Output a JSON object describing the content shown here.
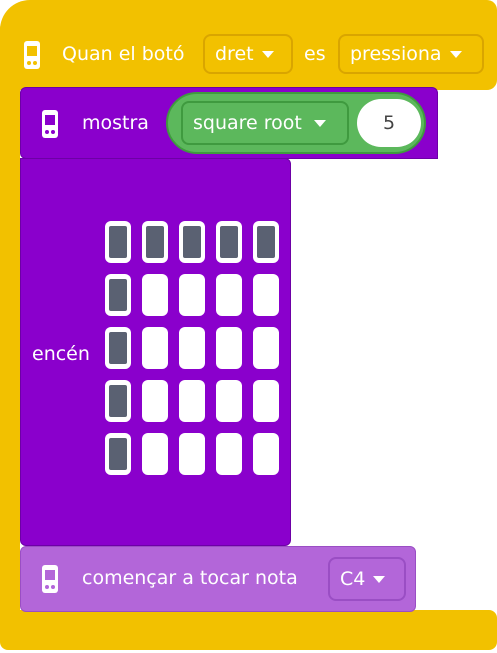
{
  "hat": {
    "label_prefix": "Quan el botó",
    "button_value": "dret",
    "label_middle": "es",
    "state_value": "pressiona",
    "color": "#f2c100"
  },
  "show_block": {
    "label": "mostra",
    "function_value": "square root",
    "number_value": "5",
    "color": "#8a00cc",
    "reporter_color": "#5cb85c"
  },
  "plot_block": {
    "label": "encén",
    "grid": [
      [
        true,
        true,
        true,
        true,
        true
      ],
      [
        true,
        false,
        false,
        false,
        false
      ],
      [
        true,
        false,
        false,
        false,
        false
      ],
      [
        true,
        false,
        false,
        false,
        false
      ],
      [
        true,
        false,
        false,
        false,
        false
      ]
    ]
  },
  "note_block": {
    "label": "començar a tocar nota",
    "note_value": "C4",
    "color": "#b366d9"
  },
  "icons": [
    "microbit-icon"
  ]
}
